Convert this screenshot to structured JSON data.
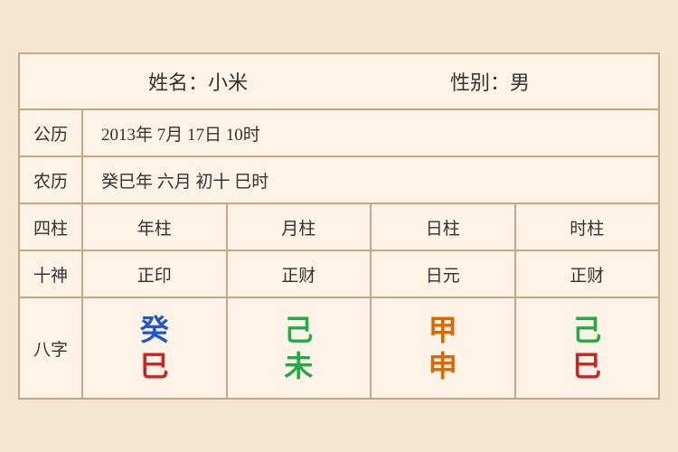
{
  "header": {
    "name_label": "姓名：小米",
    "gender_label": "性别：男"
  },
  "gregorian": {
    "label": "公历",
    "value": "2013年 7月 17日 10时"
  },
  "lunar": {
    "label": "农历",
    "value": "癸巳年 六月 初十 巳时"
  },
  "columns": {
    "label": "四柱",
    "year": "年柱",
    "month": "月柱",
    "day": "日柱",
    "hour": "时柱"
  },
  "shishen": {
    "label": "十神",
    "year": "正印",
    "month": "正财",
    "day": "日元",
    "hour": "正财"
  },
  "bazhi": {
    "label": "八字",
    "year_top": "癸",
    "year_bottom": "巳",
    "month_top": "己",
    "month_bottom": "未",
    "day_top": "甲",
    "day_bottom": "申",
    "hour_top": "己",
    "hour_bottom": "巳"
  }
}
